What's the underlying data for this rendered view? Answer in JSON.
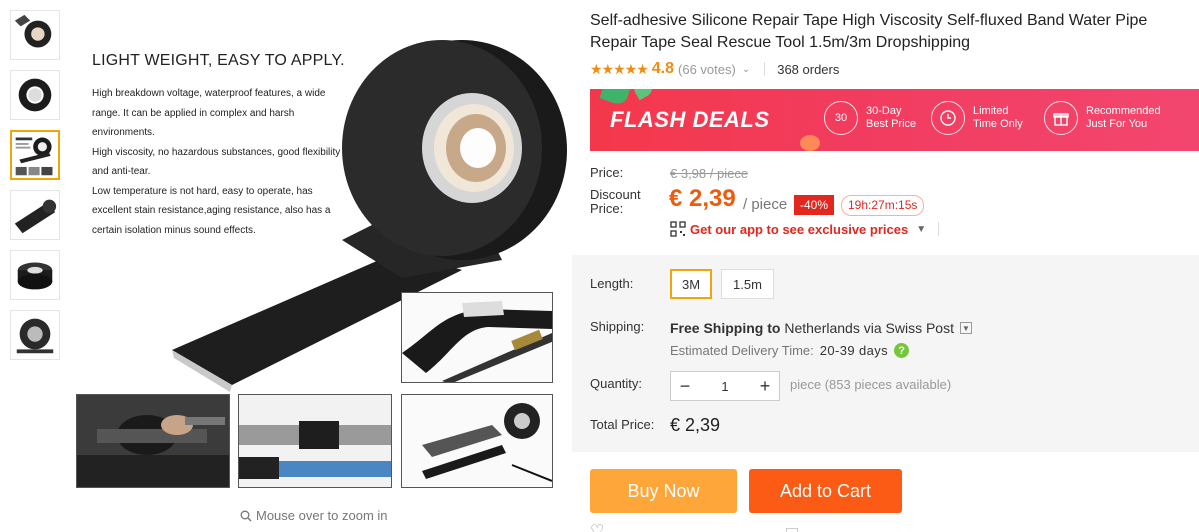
{
  "product": {
    "title": "Self-adhesive Silicone Repair Tape High Viscosity Self-fluxed Band Water Pipe Repair Tape Seal Rescue Tool 1.5m/3m Dropshipping"
  },
  "rating": {
    "stars": "★★★★★",
    "value": "4.8",
    "votes": "(66 votes)",
    "orders": "368 orders"
  },
  "gallery": {
    "heading": "LIGHT WEIGHT, EASY TO APPLY.",
    "paragraphs": [
      "High breakdown voltage, waterproof features, a wide range. It can be applied in complex and harsh environments.",
      "High viscosity, no hazardous substances, good flexibility and anti-tear.",
      "Low temperature is not hard, easy to operate, has excellent stain resistance,aging resistance, also has a certain isolation minus sound effects."
    ],
    "zoom_hint": "Mouse over to zoom in",
    "thumbnail_count": 6,
    "active_thumbnail": 3
  },
  "flash": {
    "title": "FLASH DEALS",
    "features": [
      {
        "icon": "30",
        "line1": "30-Day",
        "line2": "Best Price"
      },
      {
        "icon": "clock-icon",
        "line1": "Limited",
        "line2": "Time Only"
      },
      {
        "icon": "gift-icon",
        "line1": "Recommended",
        "line2": "Just For You"
      }
    ]
  },
  "pricing": {
    "price_label": "Price:",
    "original_price": "€ 3,98 / piece",
    "discount_label": "Discount Price:",
    "discount_price": "€ 2,39",
    "per_piece": "/ piece",
    "discount_pct": "-40%",
    "timer": "19h:27m:15s",
    "app_promo": "Get our app to see exclusive prices"
  },
  "options": {
    "length_label": "Length:",
    "lengths": [
      "3M",
      "1.5m"
    ],
    "selected_length": "3M",
    "shipping_label": "Shipping:",
    "shipping_prefix": "Free Shipping to",
    "shipping_country": "Netherlands via Swiss Post",
    "delivery_label": "Estimated Delivery Time:",
    "delivery_days": "20-39 days",
    "quantity_label": "Quantity:",
    "quantity": "1",
    "stock_info": "piece (853 pieces available)",
    "total_label": "Total Price:",
    "total": "€ 2,39"
  },
  "actions": {
    "buy_now": "Buy Now",
    "add_to_cart": "Add to Cart"
  },
  "colors": {
    "accent_orange": "#f05a0d",
    "buy_now": "#ffa63a",
    "add_to_cart": "#fb5b14",
    "flash_red": "#f23c5f",
    "star": "#f28c0f"
  }
}
